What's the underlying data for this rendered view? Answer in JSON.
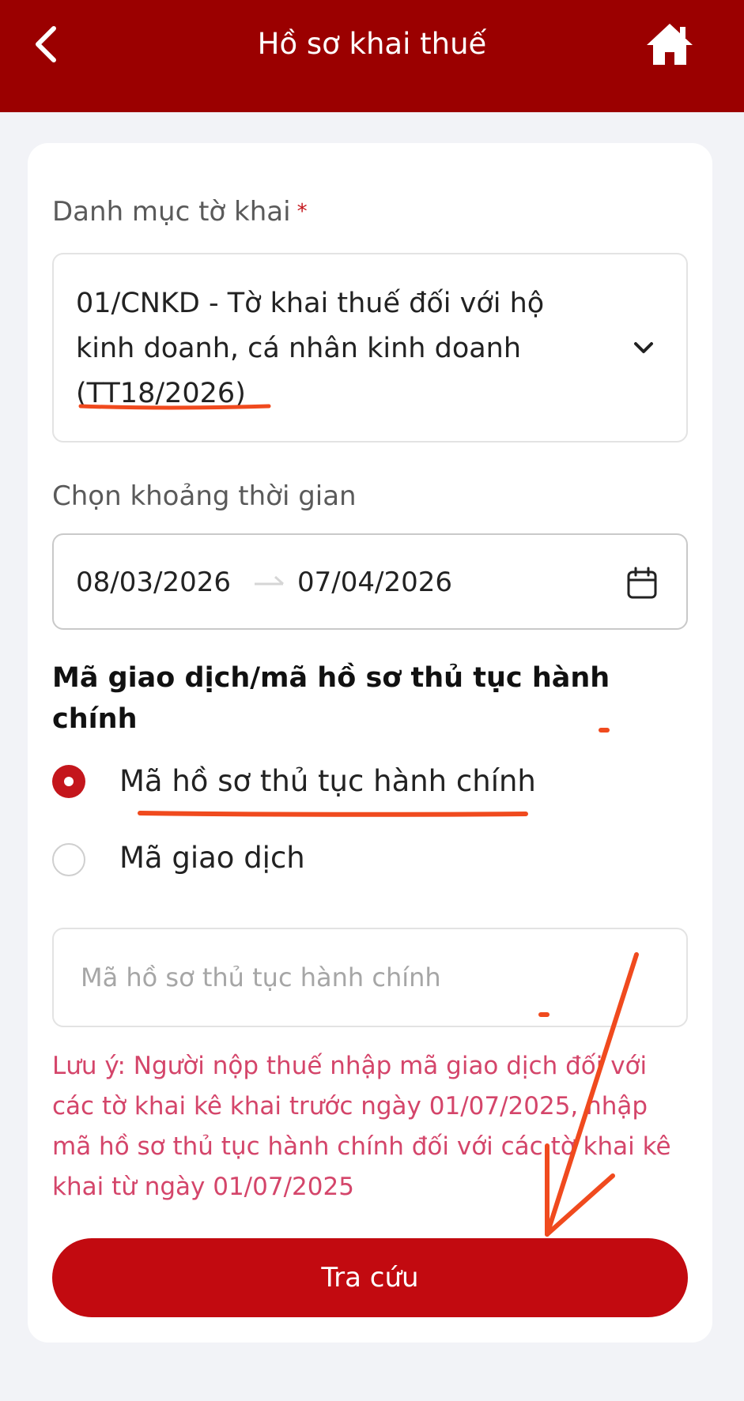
{
  "header": {
    "title": "Hồ sơ khai thuế",
    "back_icon": "back-arrow-icon",
    "home_icon": "home-icon"
  },
  "form": {
    "category_label": "Danh mục tờ khai",
    "required_mark": "*",
    "category_value": "01/CNKD - Tờ khai thuế đối với hộ kinh doanh, cá nhân kinh doanh (TT18/2026)",
    "period_label": "Chọn khoảng thời gian",
    "date_from": "08/03/2026",
    "date_to": "07/04/2026",
    "code_section_title": "Mã giao dịch/mã hồ sơ thủ tục hành chính",
    "radio_options": [
      {
        "label": "Mã hồ sơ thủ tục hành chính",
        "selected": true
      },
      {
        "label": "Mã giao dịch",
        "selected": false
      }
    ],
    "code_input_value": "",
    "code_input_placeholder": "Mã hồ sơ thủ tục hành chính",
    "note": "Lưu ý: Người nộp thuế nhập mã giao dịch đối với các tờ khai kê khai trước ngày 01/07/2025, nhập mã hồ sơ thủ tục hành chính đối với các tờ khai kê khai từ ngày 01/07/2025",
    "submit_label": "Tra cứu"
  },
  "colors": {
    "header_bg": "#9b0000",
    "primary": "#c20a10",
    "note_text": "#d4456a",
    "annotation": "#f04a1e"
  }
}
